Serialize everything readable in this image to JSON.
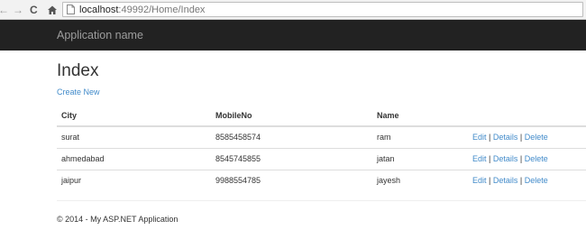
{
  "browser": {
    "url_host": "localhost",
    "url_rest": ":49992/Home/Index",
    "back_icon": "arrow-left",
    "forward_icon": "arrow-right",
    "reload_icon": "reload",
    "home_icon": "home",
    "page_icon": "document"
  },
  "navbar": {
    "brand": "Application name"
  },
  "main": {
    "title": "Index",
    "create_link": "Create New"
  },
  "table": {
    "headers": {
      "city": "City",
      "mobile": "MobileNo",
      "name": "Name"
    },
    "rows": [
      {
        "city": "surat",
        "mobile": "8585458574",
        "name": "ram"
      },
      {
        "city": "ahmedabad",
        "mobile": "8545745855",
        "name": "jatan"
      },
      {
        "city": "jaipur",
        "mobile": "9988554785",
        "name": "jayesh"
      }
    ],
    "actions": {
      "edit": "Edit",
      "details": "Details",
      "delete": "Delete",
      "separator": "|"
    }
  },
  "footer": {
    "text": "© 2014 - My ASP.NET Application"
  },
  "colors": {
    "navbar": "#222222",
    "link": "#428bca",
    "brand_text": "#9d9d9d"
  }
}
